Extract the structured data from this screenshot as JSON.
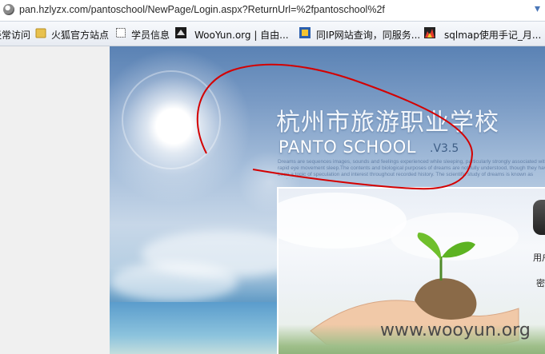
{
  "browser": {
    "url": "pan.hzlyzx.com/pantoschool/NewPage/Login.aspx?ReturnUrl=%2fpantoschool%2f",
    "bookmarks": [
      {
        "label": "经常访问",
        "icon": "star-icon"
      },
      {
        "label": "火狐官方站点",
        "icon": "folder-icon"
      },
      {
        "label": "学员信息",
        "icon": "page-icon"
      },
      {
        "label": "WooYun.org | 自由...",
        "icon": "wooyun-icon"
      },
      {
        "label": "同IP网站查询，同服务...",
        "icon": "ip-query-icon"
      },
      {
        "label": "sqlmap使用手记_月...",
        "icon": "sqlmap-icon"
      }
    ]
  },
  "page": {
    "school_name_cn": "杭州市旅游职业学校",
    "school_name_en": "PANTO SCHOOL",
    "version": ".V3.5",
    "tagline": "Dreams are sequences images, sounds and feelings experienced while sleeping, particularly strongly associated with rapid eye movement sleep.The contents and biological purposes of dreams are not fully understood, though they have been a topic of speculation and interest throughout recorded history. The scientific study of dreams is known as oneirology.",
    "username_label": "用户",
    "password_label": "密",
    "watermark": "www.wooyun.org"
  },
  "colors": {
    "annotation": "#d40000",
    "sky_top": "#5a82b4",
    "title_text": "#f2f6fb"
  }
}
